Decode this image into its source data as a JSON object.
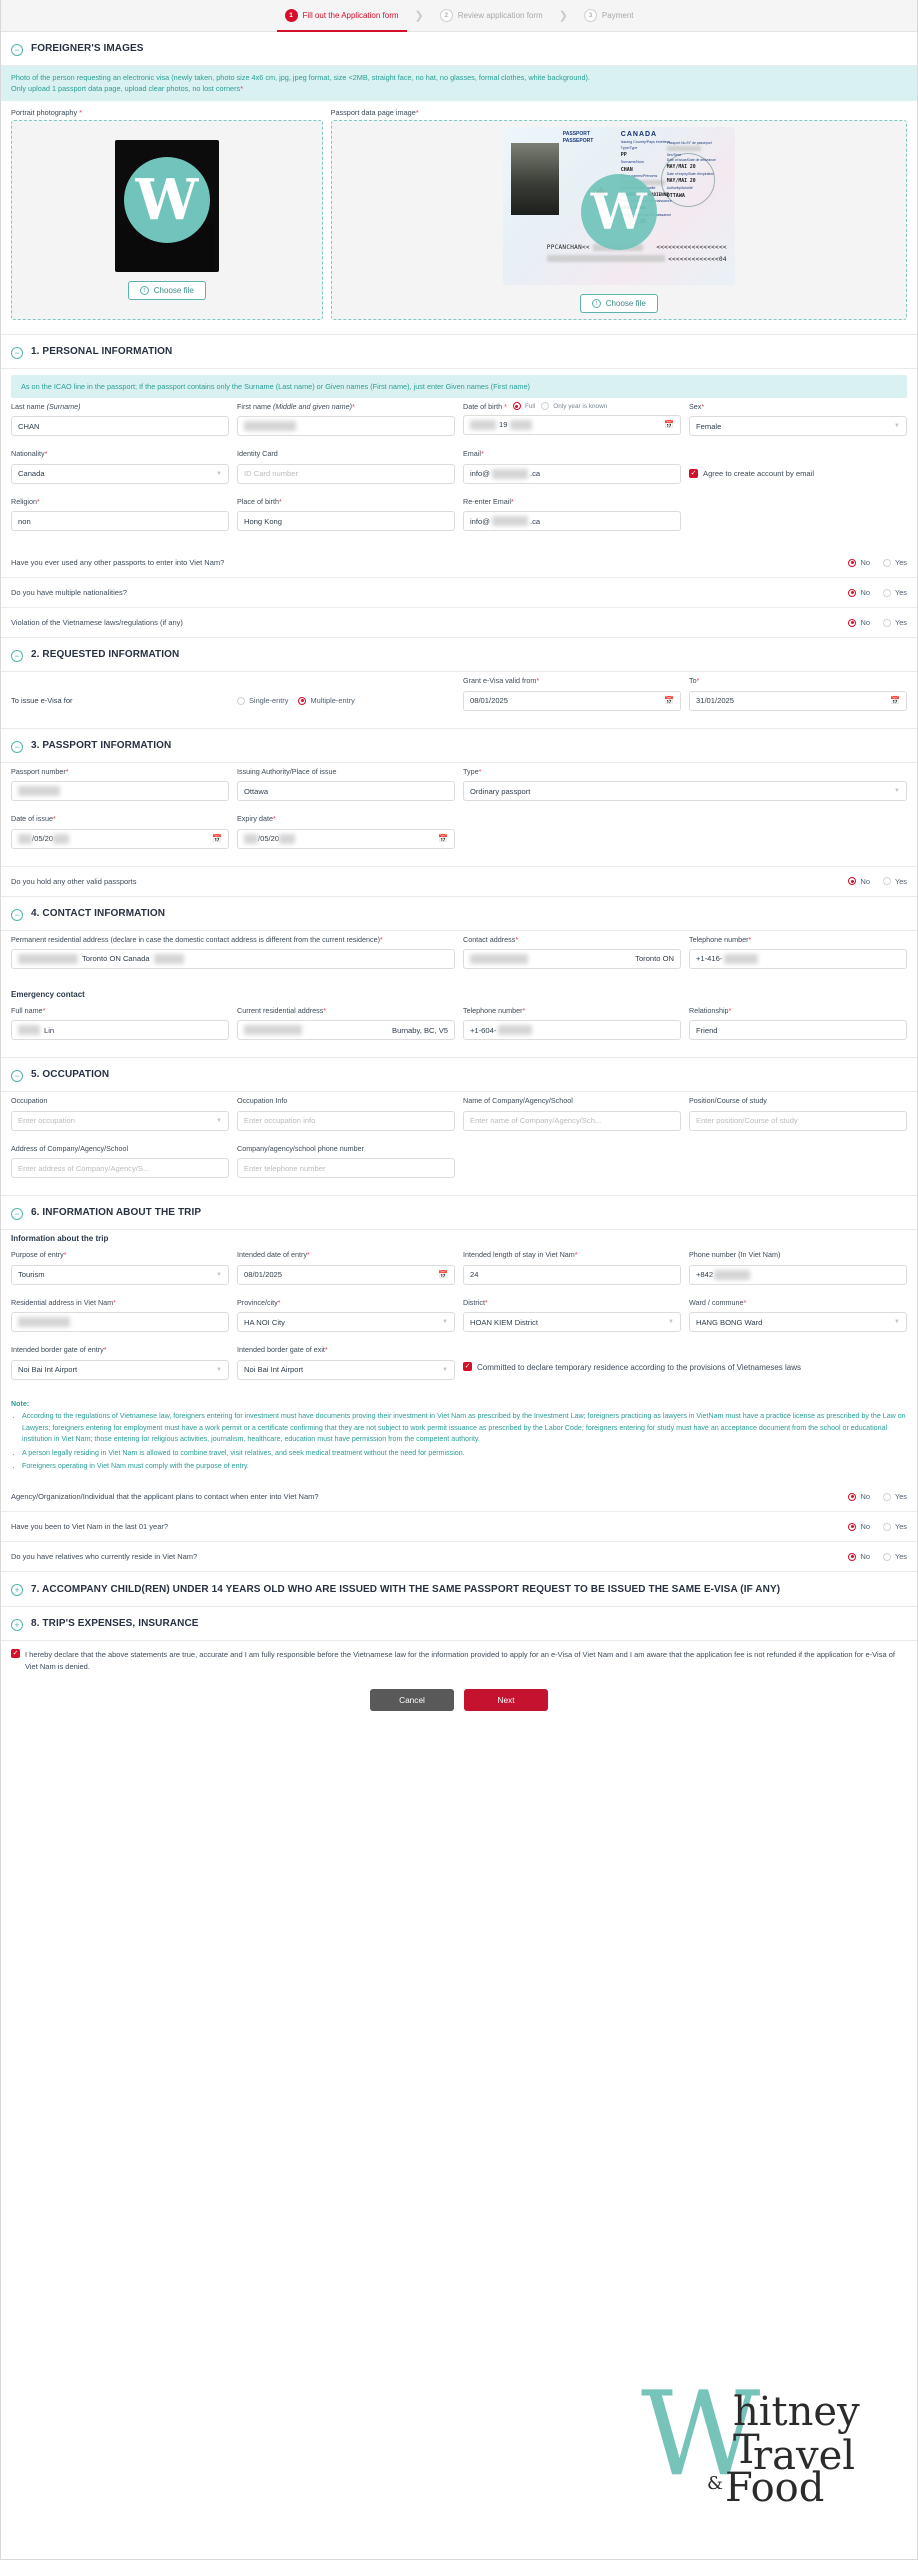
{
  "stepper": {
    "steps": [
      {
        "num": "1",
        "label": "Fill out the Application form",
        "state": "active"
      },
      {
        "num": "2",
        "label": "Review application form",
        "state": "inactive"
      },
      {
        "num": "3",
        "label": "Payment",
        "state": "inactive"
      }
    ]
  },
  "images_section": {
    "title": "FOREIGNER'S IMAGES",
    "toggle": "−",
    "banner_line1": "Photo of the person requesting an electronic visa (newly taken, photo size 4x6 cm, jpg, jpeg format, size <2MB, straight face, no hat, no glasses, formal clothes, white background).",
    "banner_line2": "Only upload 1 passport data page, upload clear photos, no lost corners",
    "banner_req": "*",
    "portrait_label": "Portrait photography",
    "passport_label": "Passport data page image",
    "choose_file": "Choose file",
    "upload_icon": "↑",
    "passport_scan": {
      "title_top": "PASSPORT",
      "title_sub": "PASSEPORT",
      "country": "CANADA",
      "country_sub1": "Issuing Country/Pays émetteur",
      "country_sub2": "Passport No./N° de passeport",
      "type_label": "Type/Type",
      "type_value": "PP",
      "surname_label": "Surname/Nom",
      "surname_value": "CHAN",
      "given_label": "Given names/Prénoms",
      "nationality_label": "Nationality/Nationalité",
      "nationality_value": "CANADIAN/CANADIENNE",
      "birthplace_label": "Place of birth/Lieu de naissance",
      "birthplace_value": "HONG KONG",
      "birthdate_label": "Date of birth/Date de naissance",
      "birthdate_value": "19",
      "sex_label": "Sex/Sexe",
      "issue_label": "Date of issue/Date de délivrance",
      "issue_value": "MAY/MAI 20",
      "expiry_label": "Date of expiry/Date d'expiration",
      "expiry_value": "MAY/MAI  20",
      "authority_label": "Authority/Autorité",
      "authority_value": "OTTAWA",
      "mrz1": "PPCANCHAN<<",
      "mrz1_tail": "<<<<<<<<<<<<<<<<<<",
      "mrz2_tail": "<<<<<<<<<<<<<04"
    }
  },
  "personal": {
    "title": "1. PERSONAL INFORMATION",
    "toggle": "−",
    "banner": "As on the ICAO line in the passport; If the passport contains only the Surname (Last name) or Given names (First name), just enter Given names (First name)",
    "last_name": {
      "label": "Last name ",
      "label_em": "(Surname)",
      "value": "CHAN"
    },
    "first_name": {
      "label": "First name ",
      "label_em": "(Middle and given name)",
      "required": "*",
      "value": ""
    },
    "dob": {
      "label": "Date of birth ",
      "required": "*",
      "opt_full": "Full",
      "opt_year": "Only year is known",
      "value": "19"
    },
    "sex": {
      "label": "Sex",
      "required": "*",
      "value": "Female"
    },
    "nationality": {
      "label": "Nationality",
      "required": "*",
      "value": "Canada"
    },
    "identity_card": {
      "label": "Identity Card",
      "placeholder": "ID Card number",
      "value": ""
    },
    "email": {
      "label": "Email",
      "required": "*",
      "value_prefix": "info@",
      "value_suffix": ".ca"
    },
    "agree_email": "Agree to create account by email",
    "religion": {
      "label": "Religion",
      "required": "*",
      "value": "non"
    },
    "place_of_birth": {
      "label": "Place of birth",
      "required": "*",
      "value": "Hong Kong"
    },
    "reenter_email": {
      "label": "Re-enter Email",
      "required": "*",
      "value_prefix": "info@",
      "value_suffix": ".ca"
    },
    "questions": [
      {
        "text": "Have you ever used any other passports to enter into Viet Nam?",
        "answer": "No"
      },
      {
        "text": "Do you have multiple nationalities?",
        "answer": "No"
      },
      {
        "text": "Violation of the Vietnamese laws/regulations (if any)",
        "answer": "No"
      }
    ],
    "no_label": "No",
    "yes_label": "Yes"
  },
  "requested": {
    "title": "2. REQUESTED INFORMATION",
    "toggle": "−",
    "issue_label": "To issue e-Visa for",
    "single_entry": "Single-entry",
    "multiple_entry": "Multiple-entry",
    "selected_entry": "Multiple-entry",
    "valid_from": {
      "label": "Grant e-Visa valid from",
      "required": "*",
      "value": "08/01/2025"
    },
    "valid_to": {
      "label": "To",
      "required": "*",
      "value": "31/01/2025"
    }
  },
  "passport_info": {
    "title": "3. PASSPORT INFORMATION",
    "toggle": "−",
    "passport_number": {
      "label": "Passport number",
      "required": "*",
      "value": ""
    },
    "issuing_authority": {
      "label": "Issuing Authority/Place of issue",
      "value": "Ottawa"
    },
    "type": {
      "label": "Type",
      "required": "*",
      "value": "Ordinary passport"
    },
    "date_of_issue": {
      "label": "Date of issue",
      "required": "*",
      "value": "/05/20"
    },
    "expiry_date": {
      "label": "Expiry date",
      "required": "*",
      "value": "/05/20"
    },
    "question": {
      "text": "Do you hold any other valid passports",
      "answer": "No"
    }
  },
  "contact": {
    "title": "4. CONTACT INFORMATION",
    "toggle": "−",
    "permanent_address": {
      "label": "Permanent residential address (declare in case the domestic contact address is different from the current residence)",
      "required": "*",
      "value": "Toronto ON  Canada"
    },
    "contact_address": {
      "label": "Contact address",
      "required": "*",
      "value": "Toronto ON"
    },
    "telephone": {
      "label": "Telephone number",
      "required": "*",
      "value": "+1-416-"
    },
    "emergency_title": "Emergency contact",
    "full_name": {
      "label": "Full name",
      "required": "*",
      "value": "Lin"
    },
    "current_address": {
      "label": "Current residential address",
      "required": "*",
      "value": "Burnaby, BC, V5"
    },
    "emergency_phone": {
      "label": "Telephone number",
      "required": "*",
      "value": "+1-604-"
    },
    "relationship": {
      "label": "Relationship",
      "required": "*",
      "value": "Friend"
    }
  },
  "occupation": {
    "title": "5. OCCUPATION",
    "toggle": "−",
    "occupation": {
      "label": "Occupation",
      "placeholder": "Enter occupation"
    },
    "occupation_info": {
      "label": "Occupation Info",
      "placeholder": "Enter occupation info"
    },
    "company_name": {
      "label": "Name of Company/Agency/School",
      "placeholder": "Enter name of Company/Agency/Sch..."
    },
    "position": {
      "label": "Position/Course of study",
      "placeholder": "Enter position/Course of study"
    },
    "company_address": {
      "label": "Address of Company/Agency/School",
      "placeholder": "Enter address of Company/Agency/S..."
    },
    "company_phone": {
      "label": "Company/agency/school phone number",
      "placeholder": "Enter telephone number"
    }
  },
  "trip": {
    "title": "6. INFORMATION ABOUT THE TRIP",
    "toggle": "−",
    "subhead": "Information about the trip",
    "purpose": {
      "label": "Purpose of entry",
      "required": "*",
      "value": "Tourism"
    },
    "intended_date": {
      "label": "Intended date of entry",
      "required": "*",
      "value": "08/01/2025"
    },
    "length_of_stay": {
      "label": "Intended length of stay in Viet Nam",
      "required": "*",
      "value": "24"
    },
    "phone_vn": {
      "label": "Phone number (In Viet Nam)",
      "value": "+842"
    },
    "residential_vn": {
      "label": "Residential address in Viet Nam",
      "required": "*",
      "value": ""
    },
    "province": {
      "label": "Province/city",
      "required": "*",
      "value": "HA NOI City"
    },
    "district": {
      "label": "District",
      "required": "*",
      "value": "HOAN KIEM District"
    },
    "ward": {
      "label": "Ward / commune",
      "required": "*",
      "value": "HANG BONG Ward"
    },
    "border_entry": {
      "label": "Intended border gate of entry",
      "required": "*",
      "value": "Noi Bai Int Airport"
    },
    "border_exit": {
      "label": "Intended border gate of exit",
      "required": "*",
      "value": "Noi Bai Int Airport"
    },
    "commit_text": "Committed to declare temporary residence according to the provisions of Vietnameses laws",
    "note_title": "Note:",
    "notes": [
      "According to the regulations of Vietnamese law, foreigners entering for investment must have documents proving their investment in Viet Nam as prescribed by the Investment Law; foreigners practicing as lawyers in VietNam must have a practice license as prescribed by the Law on Lawyers; foreigners entering for employment must have a work permit or a certificate confirming that they are not subject to work permit issuance as prescribed by the Labor Code; foreigners entering for study must have an acceptance document from the school or educational institution in Viet Nam; those entering for religious activities, journalism, healthcare, education must have permission from the competent authority.",
      "A person legally residing in Viet Nam is allowed to combine travel, visit relatives, and seek medical treatment without the need for permission.",
      "Foreigners operating in Viet Nam must comply with the purpose of entry."
    ],
    "questions": [
      {
        "text": "Agency/Organization/Individual that the applicant plans to contact when enter into Viet Nam?",
        "answer": "No"
      },
      {
        "text": "Have you been to Viet Nam in the last 01 year?",
        "answer": "No"
      },
      {
        "text": "Do you have relatives who currently reside in Viet Nam?",
        "answer": "No"
      }
    ]
  },
  "accompany": {
    "title": "7. ACCOMPANY CHILD(REN) UNDER 14 YEARS OLD WHO ARE ISSUED WITH THE SAME PASSPORT REQUEST TO BE ISSUED THE SAME E-VISA (IF ANY)",
    "toggle": "+"
  },
  "expenses": {
    "title": "8. TRIP'S EXPENSES, INSURANCE",
    "toggle": "+"
  },
  "footer": {
    "declaration": "I hereby declare that the above statements are true, accurate and I am fully responsible before the Vietnamese law for the information provided to apply for an e-Visa of Viet Nam and I am aware that the application fee is not refunded if the application for e-Visa of Viet Nam is denied.",
    "cancel": "Cancel",
    "next": "Next"
  },
  "watermark": {
    "w": "W",
    "line1": "hitney",
    "line2": "ravel",
    "line3": "&",
    "line4": "T",
    "line5": "Food"
  }
}
